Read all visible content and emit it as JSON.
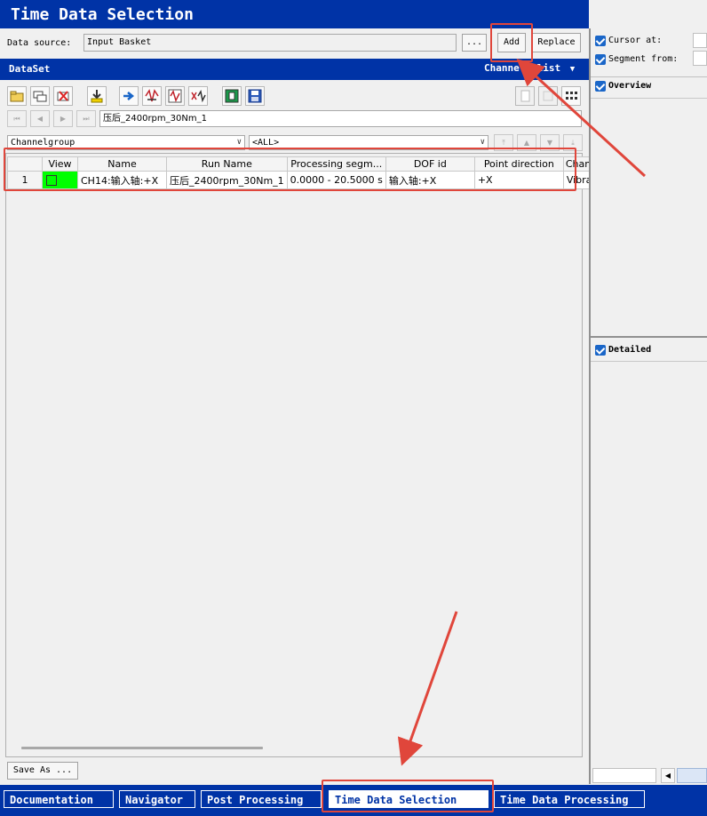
{
  "title": "Time Data Selection",
  "data_source": {
    "label": "Data source:",
    "value": "Input Basket",
    "browse_label": "...",
    "add_label": "Add",
    "replace_label": "Replace"
  },
  "dataset": {
    "title": "DataSet",
    "channels_list_label": "Channels list"
  },
  "run_field": "压后_2400rpm_30Nm_1",
  "channelgroup_combo": "Channelgroup",
  "all_combo": "<ALL>",
  "table": {
    "headers": [
      "",
      "View",
      "Name",
      "Run Name",
      "Processing segm...",
      "DOF id",
      "Point direction",
      "Channelgro"
    ],
    "rows": [
      {
        "index": "1",
        "name": "CH14:输入轴:+X",
        "run_name": "压后_2400rpm_30Nm_1",
        "segment": "0.0000 - 20.5000 s",
        "dof_id": "输入轴:+X",
        "point_direction": "+X",
        "channelgroup": "Vibration"
      }
    ]
  },
  "save_as_label": "Save As ...",
  "right_panel": {
    "cursor_at_label": "Cursor at:",
    "segment_from_label": "Segment from:",
    "overview_label": "Overview",
    "detailed_label": "Detailed"
  },
  "tabs": [
    "Documentation",
    "Navigator",
    "Post Processing",
    "Time Data Selection",
    "Time Data Processing"
  ],
  "colors": {
    "brand_blue": "#0033a6",
    "annotation_red": "#e0463b",
    "view_cell_green": "#00ff00"
  }
}
